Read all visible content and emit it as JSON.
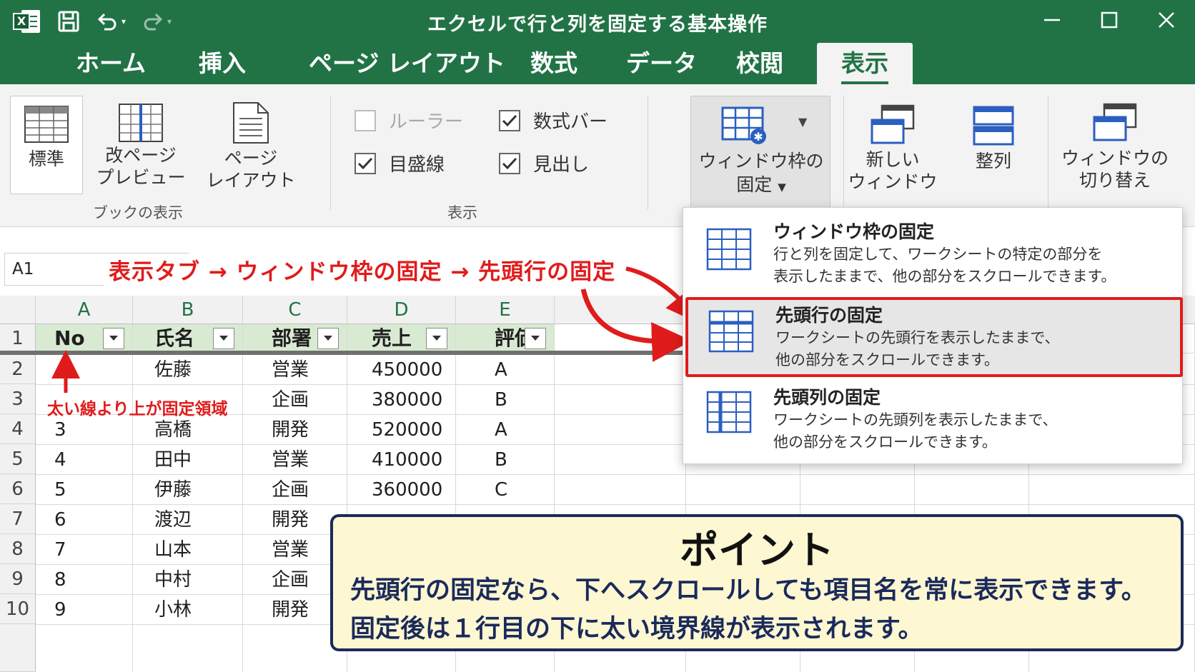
{
  "window": {
    "title": "エクセルで行と列を固定する基本操作",
    "icons": [
      "excel-logo",
      "save-icon",
      "undo-icon",
      "redo-icon",
      "minimize-icon",
      "maximize-icon",
      "close-icon"
    ]
  },
  "tabs": [
    {
      "label": "ホーム",
      "active": false
    },
    {
      "label": "挿入",
      "active": false
    },
    {
      "label": "ページ レイアウト",
      "active": false
    },
    {
      "label": "数式",
      "active": false
    },
    {
      "label": "データ",
      "active": false
    },
    {
      "label": "校閲",
      "active": false
    },
    {
      "label": "表示",
      "active": true
    }
  ],
  "ribbon": {
    "book_view": {
      "group_label": "ブックの表示",
      "normal": "標準",
      "page_break_1": "改ページ",
      "page_break_2": "プレビュー",
      "page_layout_1": "ページ",
      "page_layout_2": "レイアウト"
    },
    "show": {
      "group_label": "表示",
      "ruler": {
        "label": "ルーラー",
        "checked": false,
        "enabled": false
      },
      "formula_bar": {
        "label": "数式バー",
        "checked": true
      },
      "gridlines": {
        "label": "目盛線",
        "checked": true
      },
      "headings": {
        "label": "見出し",
        "checked": true
      }
    },
    "window": {
      "freeze_1": "ウィンドウ枠の",
      "freeze_2": "固定",
      "new_window_1": "新しい",
      "new_window_2": "ウィンドウ",
      "arrange": "整列",
      "switch_1": "ウィンドウの",
      "switch_2": "切り替え"
    }
  },
  "name_box": "A1",
  "annotation_main": "表示タブ → ウィンドウ枠の固定 → 先頭行の固定",
  "annotation_frozen": "太い線より上が固定領域",
  "sheet": {
    "columns": [
      "A",
      "B",
      "C",
      "D",
      "E"
    ],
    "row_numbers": [
      "1",
      "2",
      "3",
      "4",
      "5",
      "6",
      "7",
      "8",
      "9",
      "10"
    ],
    "header": [
      "No",
      "氏名",
      "部署",
      "売上",
      "評価"
    ],
    "rows": [
      [
        "",
        "佐藤",
        "営業",
        "450000",
        "A"
      ],
      [
        "",
        "",
        "企画",
        "380000",
        "B"
      ],
      [
        "3",
        "高橋",
        "開発",
        "520000",
        "A"
      ],
      [
        "4",
        "田中",
        "営業",
        "410000",
        "B"
      ],
      [
        "5",
        "伊藤",
        "企画",
        "360000",
        "C"
      ],
      [
        "6",
        "渡辺",
        "開発",
        "",
        ""
      ],
      [
        "7",
        "山本",
        "営業",
        "",
        ""
      ],
      [
        "8",
        "中村",
        "企画",
        "",
        ""
      ],
      [
        "9",
        "小林",
        "開発",
        "",
        ""
      ]
    ]
  },
  "freeze_menu": [
    {
      "title": "ウィンドウ枠の固定",
      "desc1": "行と列を固定して、ワークシートの特定の部分を",
      "desc2": "表示したままで、他の部分をスクロールできます。",
      "highlighted": false
    },
    {
      "title": "先頭行の固定",
      "desc1": "ワークシートの先頭行を表示したままで、",
      "desc2": "他の部分をスクロールできます。",
      "highlighted": true
    },
    {
      "title": "先頭列の固定",
      "desc1": "ワークシートの先頭列を表示したままで、",
      "desc2": "他の部分をスクロールできます。",
      "highlighted": false
    }
  ],
  "point": {
    "heading": "ポイント",
    "line1": "先頭行の固定なら、下へスクロールしても項目名を常に表示できます。",
    "line2": "固定後は１行目の下に太い境界線が表示されます。"
  },
  "colors": {
    "excel_green": "#217346",
    "highlight_red": "#e01b1b",
    "header_fill": "#d9ead3",
    "point_bg": "#fdf7d2",
    "point_border": "#1b2a5b"
  }
}
